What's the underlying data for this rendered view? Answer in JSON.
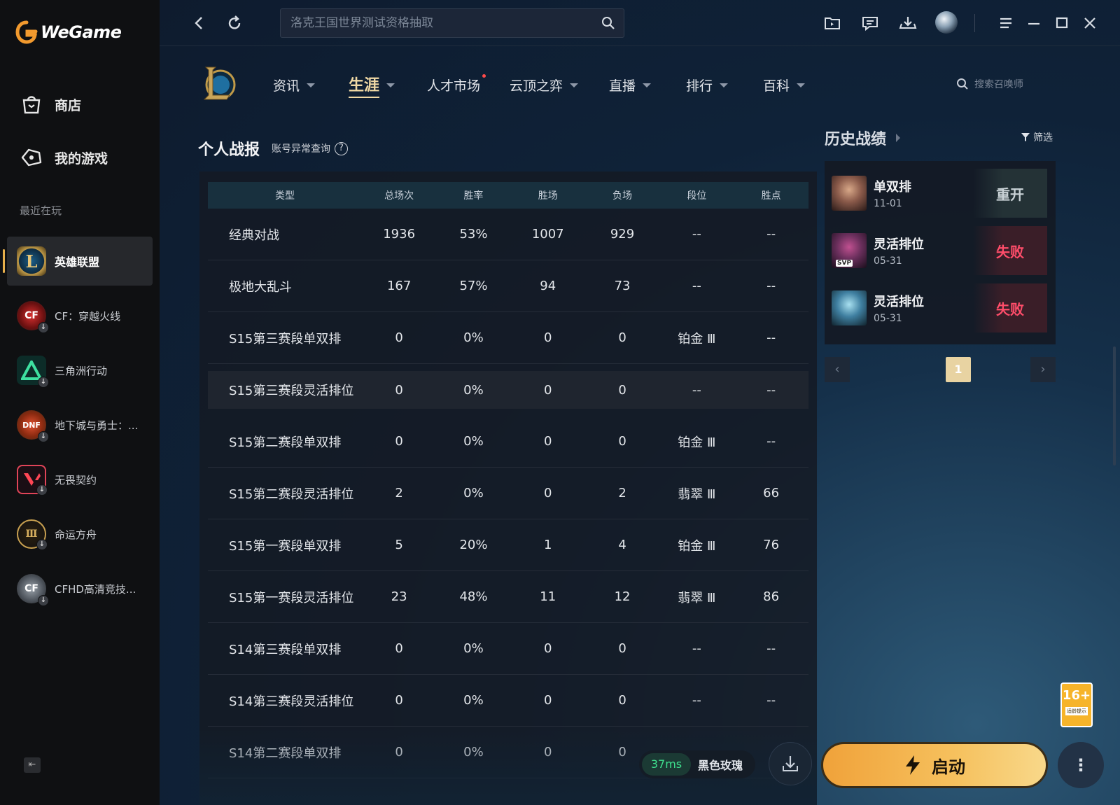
{
  "app": {
    "brand": "WeGame",
    "accent_color": "#e8b04b"
  },
  "sidebar": {
    "nav": [
      {
        "label": "商店",
        "icon": "shopping-bag-icon"
      },
      {
        "label": "我的游戏",
        "icon": "gamepad-icon"
      }
    ],
    "recent_label": "最近在玩",
    "games": [
      {
        "name": "英雄联盟",
        "icon": "league-of-legends-icon",
        "active": true
      },
      {
        "name": "CF：穿越火线",
        "icon": "crossfire-icon"
      },
      {
        "name": "三角洲行动",
        "icon": "delta-force-icon"
      },
      {
        "name": "地下城与勇士：...",
        "icon": "dnf-icon"
      },
      {
        "name": "无畏契约",
        "icon": "valorant-icon"
      },
      {
        "name": "命运方舟",
        "icon": "lost-ark-icon"
      },
      {
        "name": "CFHD高清竞技...",
        "icon": "cfhd-icon"
      }
    ]
  },
  "topbar": {
    "search_placeholder": "洛克王国世界测试资格抽取"
  },
  "game_nav": {
    "tabs": [
      {
        "label": "资讯"
      },
      {
        "label": "生涯",
        "active": true
      },
      {
        "label": "人才市场"
      },
      {
        "label": "云顶之弈"
      },
      {
        "label": "直播"
      },
      {
        "label": "排行"
      },
      {
        "label": "百科"
      }
    ],
    "summoner_search_placeholder": "搜索召唤师"
  },
  "personal": {
    "title": "个人战报",
    "account_check_label": "账号异常查询",
    "help_glyph": "?",
    "columns": [
      "类型",
      "总场次",
      "胜率",
      "胜场",
      "负场",
      "段位",
      "胜点"
    ],
    "rows": [
      [
        "经典对战",
        "1936",
        "53%",
        "1007",
        "929",
        "--",
        "--"
      ],
      [
        "极地大乱斗",
        "167",
        "57%",
        "94",
        "73",
        "--",
        "--"
      ],
      [
        "S15第三赛段单双排",
        "0",
        "0%",
        "0",
        "0",
        "铂金 Ⅲ",
        "--"
      ],
      [
        "S15第三赛段灵活排位",
        "0",
        "0%",
        "0",
        "0",
        "--",
        "--"
      ],
      [
        "S15第二赛段单双排",
        "0",
        "0%",
        "0",
        "0",
        "铂金 Ⅲ",
        "--"
      ],
      [
        "S15第二赛段灵活排位",
        "2",
        "0%",
        "0",
        "2",
        "翡翠 Ⅲ",
        "66"
      ],
      [
        "S15第一赛段单双排",
        "5",
        "20%",
        "1",
        "4",
        "铂金 Ⅲ",
        "76"
      ],
      [
        "S15第一赛段灵活排位",
        "23",
        "48%",
        "11",
        "12",
        "翡翠 Ⅲ",
        "86"
      ],
      [
        "S14第三赛段单双排",
        "0",
        "0%",
        "0",
        "0",
        "--",
        "--"
      ],
      [
        "S14第三赛段灵活排位",
        "0",
        "0%",
        "0",
        "0",
        "--",
        "--"
      ],
      [
        "S14第二赛段单双排",
        "0",
        "0%",
        "0",
        "0",
        "",
        ""
      ]
    ]
  },
  "history": {
    "title": "历史战绩",
    "filter_label": "筛选",
    "matches": [
      {
        "mode": "单双排",
        "date": "11-01",
        "result": "重开",
        "result_type": "remake",
        "champion_color": "#8a5a4a"
      },
      {
        "mode": "灵活排位",
        "date": "05-31",
        "result": "失败",
        "result_type": "loss",
        "champion_color": "#6a2f5c",
        "badge": "SVP"
      },
      {
        "mode": "灵活排位",
        "date": "05-31",
        "result": "失败",
        "result_type": "loss",
        "champion_color": "#3f7fa0"
      }
    ],
    "page": "1"
  },
  "bottom": {
    "ping": "37ms",
    "server": "黑色玫瑰",
    "launch_label": "启动",
    "more_glyph": "⋮",
    "age_rating": "16+",
    "age_text": "适龄提示"
  }
}
